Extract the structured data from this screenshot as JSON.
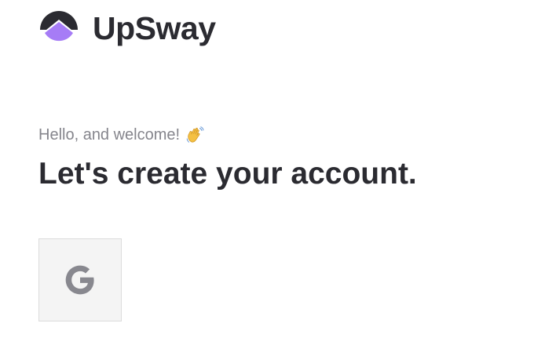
{
  "brand": {
    "name": "UpSway",
    "logo_icon": "upsway-logo-icon",
    "colors": {
      "dark": "#2b2b31",
      "accent": "#a67cf6"
    }
  },
  "welcome": {
    "greeting": "Hello, and welcome!",
    "greeting_icon": "waving-hand-icon",
    "headline": "Let's create your account."
  },
  "social_login": {
    "google_icon": "google-icon",
    "button_color": "#f4f4f4"
  }
}
